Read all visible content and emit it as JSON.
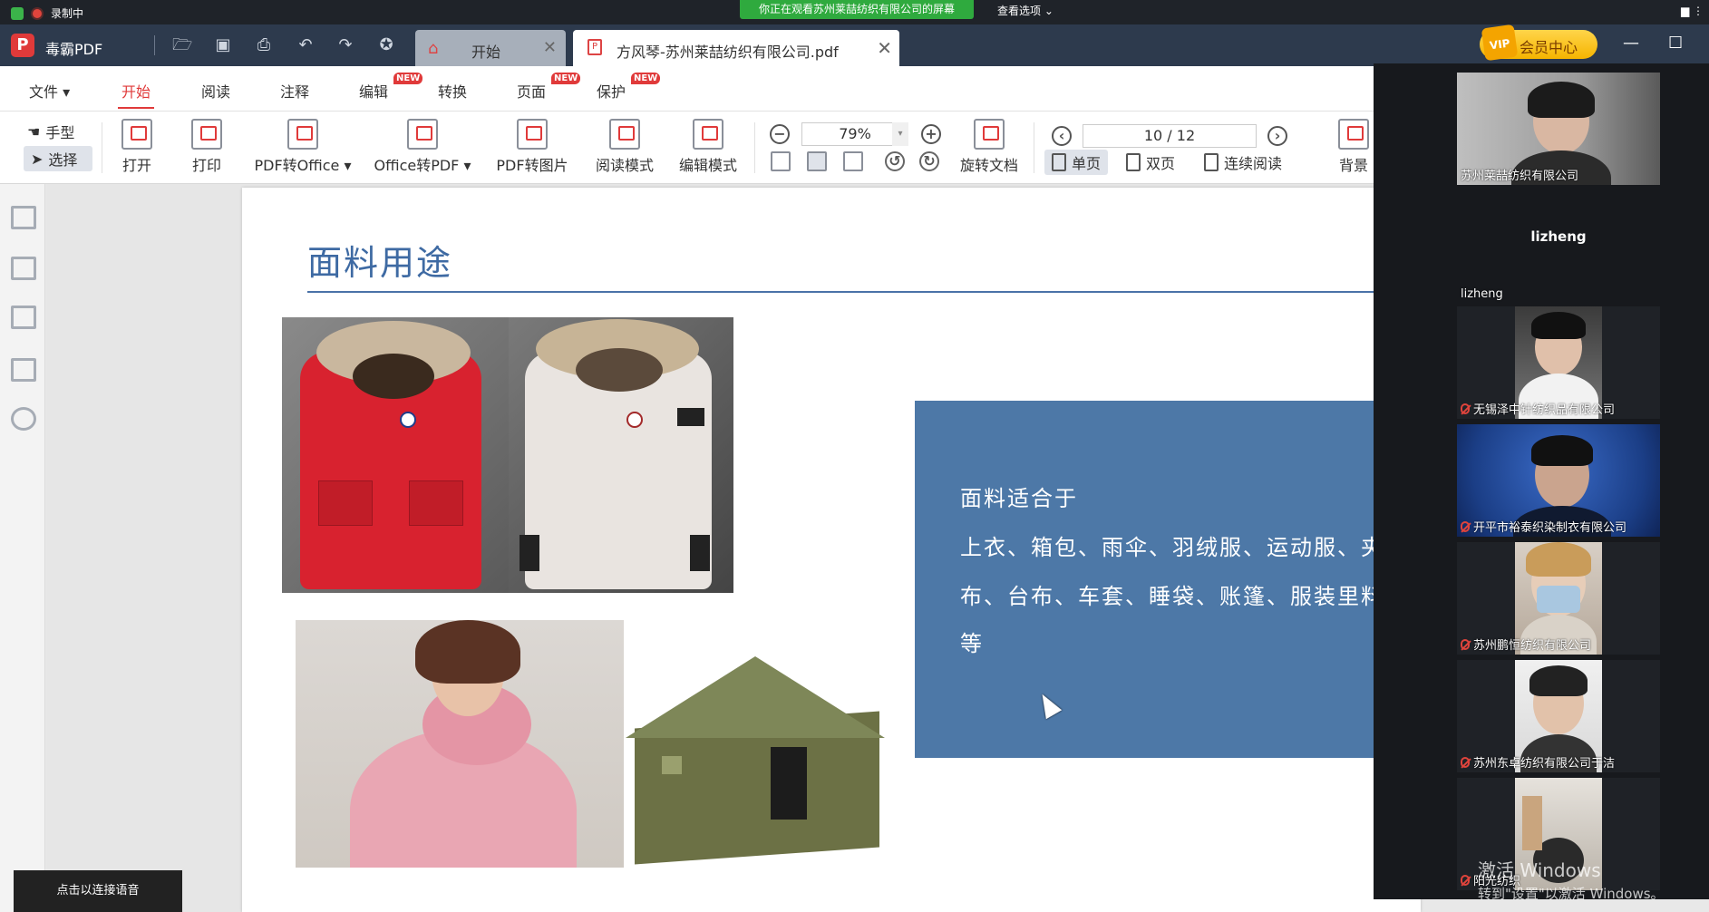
{
  "meeting": {
    "recording_label": "录制中",
    "sharing_banner": "你正在观看苏州莱喆纺织有限公司的屏幕",
    "view_options": "查看选项 ⌄",
    "right_glyph": "▆ ⋮"
  },
  "app": {
    "logo_letter": "P",
    "name": "毒霸PDF",
    "tabs": [
      {
        "label": "开始"
      },
      {
        "label": "方风琴-苏州莱喆纺织有限公司.pdf"
      }
    ],
    "vip_label": "会员中心",
    "vip_badge": "VIP"
  },
  "menu": {
    "items": [
      "文件",
      "开始",
      "阅读",
      "注释",
      "编辑",
      "转换",
      "页面",
      "保护"
    ],
    "file_arrow": "▾",
    "new_badge": "NEW"
  },
  "toolbar": {
    "hand": "手型",
    "select": "选择",
    "open": "打开",
    "print": "打印",
    "pdf_to_office": "PDF转Office ▾",
    "office_to_pdf": "Office转PDF ▾",
    "pdf_to_image": "PDF转图片",
    "read_mode": "阅读模式",
    "edit_mode": "编辑模式",
    "zoom": "79%",
    "zoom_arrow": "▾",
    "rotate_doc": "旋转文档",
    "page_indicator": "10 / 12",
    "single_page": "单页",
    "double_page": "双页",
    "continuous": "连续阅读",
    "background": "背景"
  },
  "document": {
    "title": "面料用途",
    "box_lines": [
      "面料适合于",
      "上衣、箱包、雨伞、羽绒服、运动服、夹",
      "布、台布、车套、睡袋、账篷、服装里料",
      "等"
    ]
  },
  "participants": [
    {
      "name": "苏州莱喆纺织有限公司",
      "muted": false
    },
    {
      "name": "lizheng",
      "label": "lizheng",
      "muted": false
    },
    {
      "name": "无锡泽中针纺织品有限公司",
      "muted": true
    },
    {
      "name": "开平市裕泰织染制衣有限公司",
      "muted": true
    },
    {
      "name": "苏州鹏恒纺织有限公司",
      "muted": true
    },
    {
      "name": "苏州东卓纺织有限公司于洁",
      "muted": true
    },
    {
      "name": "阳光纺织",
      "muted": true
    }
  ],
  "footer": {
    "connect_voice": "点击以连接语音",
    "activate_title": "激活 Windows",
    "activate_sub": "转到\"设置\"以激活 Windows。"
  },
  "colors": {
    "accent": "#e03a3a",
    "titlebar": "#2d3a4d",
    "doc_blue": "#4d78a7",
    "share_green": "#2faa3e"
  }
}
